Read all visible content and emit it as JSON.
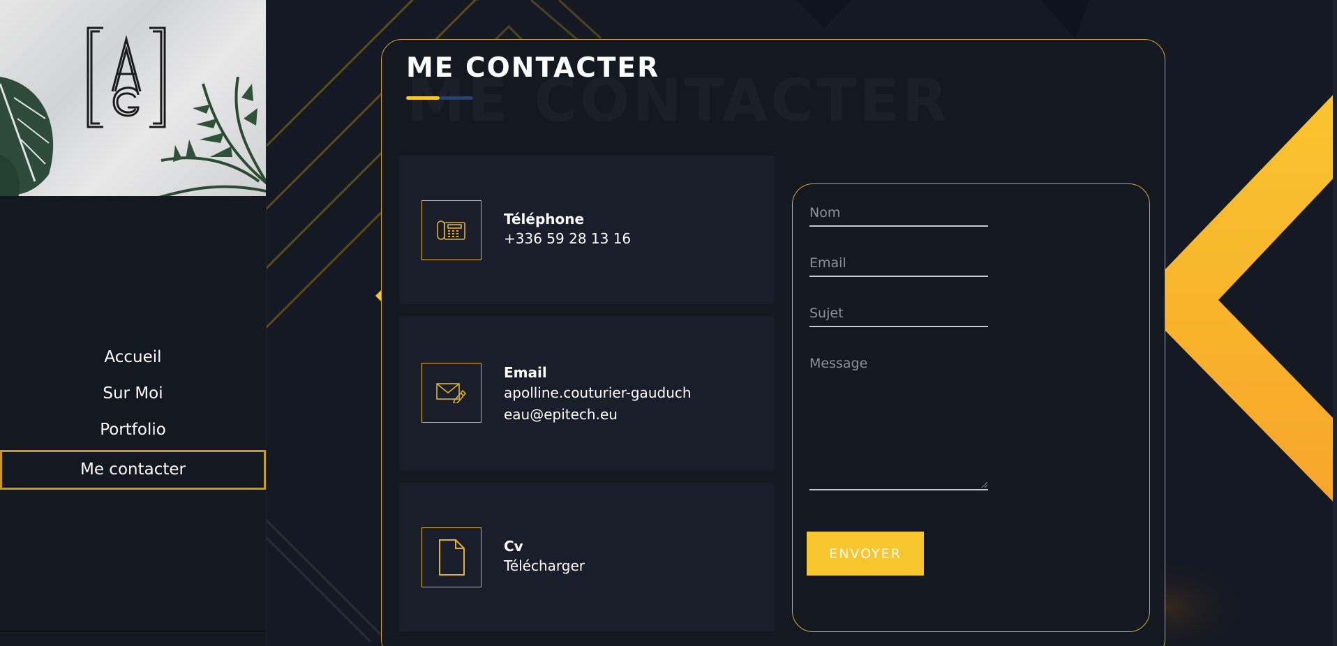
{
  "sidebar": {
    "nav": [
      {
        "label": "Accueil"
      },
      {
        "label": "Sur Moi"
      },
      {
        "label": "Portfolio"
      },
      {
        "label": "Me contacter",
        "active": true
      }
    ]
  },
  "contact": {
    "title": "ME CONTACTER",
    "ghost_title": "ME CONTACTER",
    "info": [
      {
        "label": "Téléphone",
        "value": "+336 59 28 13 16",
        "icon": "telephone-icon"
      },
      {
        "label": "Email",
        "value": "apolline.couturier-gauducheau@epitech.eu",
        "icon": "email-icon"
      },
      {
        "label": "Cv",
        "value": "Télécharger",
        "icon": "document-icon"
      }
    ],
    "form": {
      "name_placeholder": "Nom",
      "email_placeholder": "Email",
      "subject_placeholder": "Sujet",
      "message_placeholder": "Message",
      "submit_label": "ENVOYER"
    }
  },
  "colors": {
    "accent": "#f6c62b",
    "background": "#141923",
    "panel": "#1a1e2b",
    "text": "#ffffff",
    "secondary_accent": "#27426a"
  }
}
